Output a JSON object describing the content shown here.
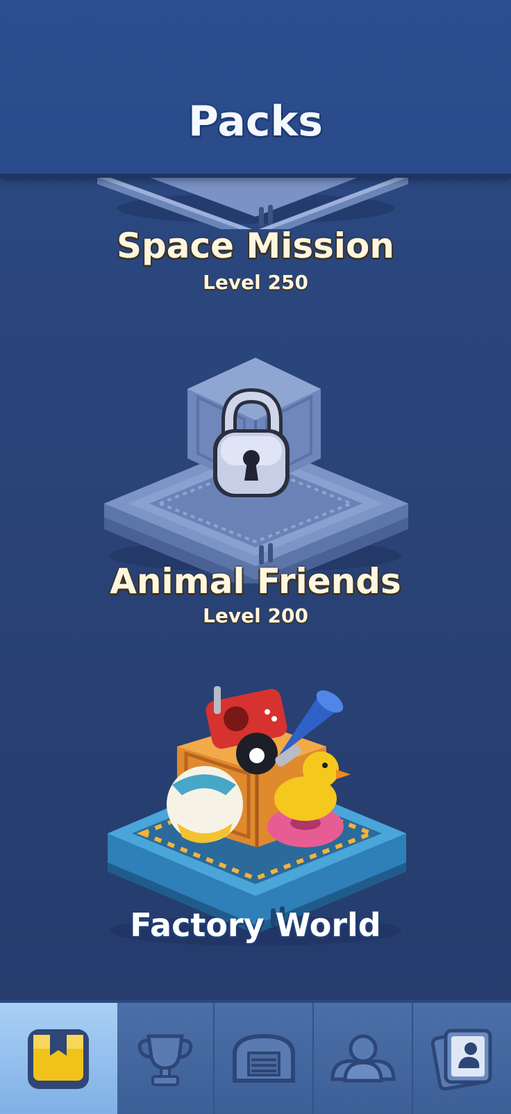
{
  "header": {
    "title": "Packs"
  },
  "packs": [
    {
      "name": "Space Mission",
      "level": "Level 250",
      "state": "locked"
    },
    {
      "name": "Animal Friends",
      "level": "Level 200",
      "state": "locked"
    },
    {
      "name": "Factory World",
      "state": "unlocked"
    }
  ],
  "bottom_nav": {
    "tabs": [
      {
        "icon": "packs-icon",
        "active": true
      },
      {
        "icon": "trophy-icon",
        "active": false
      },
      {
        "icon": "home-icon",
        "active": false
      },
      {
        "icon": "team-icon",
        "active": false
      },
      {
        "icon": "collection-icon",
        "active": false
      }
    ]
  },
  "colors": {
    "background": "#2a4377",
    "header": "#2d4f8f",
    "active_tab": "#8fbcec",
    "gold": "#f0c21a"
  }
}
